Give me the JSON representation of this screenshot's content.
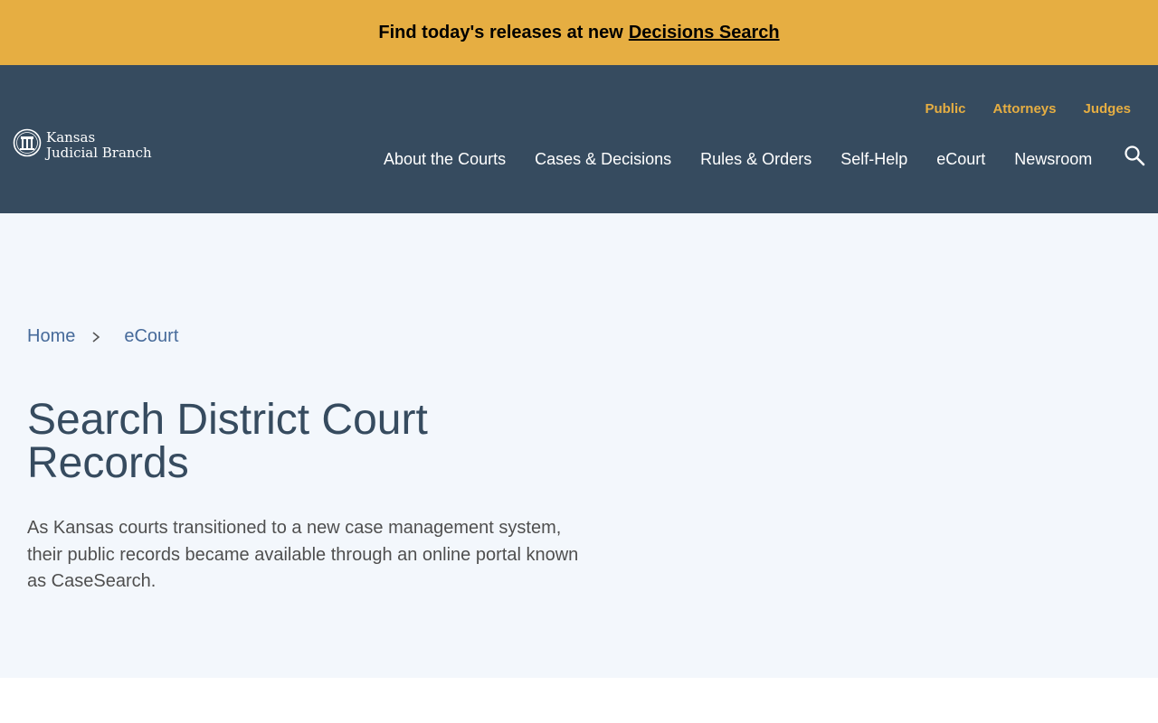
{
  "alert": {
    "text": "Find today's releases at new",
    "link_label": "Decisions Search"
  },
  "logo": {
    "line1": "Kansas",
    "line2": "Judicial Branch"
  },
  "audience_nav": [
    {
      "label": "Public"
    },
    {
      "label": "Attorneys"
    },
    {
      "label": "Judges"
    }
  ],
  "main_nav": [
    {
      "label": "About the Courts"
    },
    {
      "label": "Cases & Decisions"
    },
    {
      "label": "Rules & Orders"
    },
    {
      "label": "Self-Help"
    },
    {
      "label": "eCourt"
    },
    {
      "label": "Newsroom"
    }
  ],
  "breadcrumb": {
    "home": "Home",
    "current": "eCourt"
  },
  "page": {
    "title": "Search District Court Records",
    "intro": "As Kansas courts transitioned to a new case management system, their public records became available through an online portal known as CaseSearch."
  },
  "icons": {
    "search": "search-icon",
    "breadcrumb_separator": "chevron-right-icon",
    "seal": "seal-icon"
  },
  "colors": {
    "alert_bg": "#e6ae42",
    "header_bg": "#364b5f",
    "audience_link": "#e6ae42",
    "hero_bg": "#f3f7fc",
    "breadcrumb_link": "#466a9a",
    "title": "#364b5f"
  }
}
